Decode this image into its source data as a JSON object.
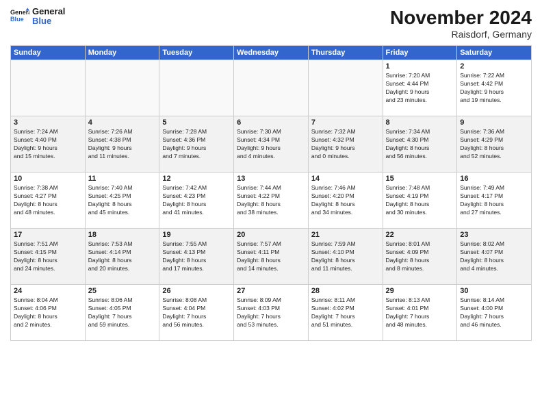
{
  "logo": {
    "line1": "General",
    "line2": "Blue"
  },
  "title": "November 2024",
  "subtitle": "Raisdorf, Germany",
  "days_of_week": [
    "Sunday",
    "Monday",
    "Tuesday",
    "Wednesday",
    "Thursday",
    "Friday",
    "Saturday"
  ],
  "weeks": [
    [
      {
        "day": "",
        "info": ""
      },
      {
        "day": "",
        "info": ""
      },
      {
        "day": "",
        "info": ""
      },
      {
        "day": "",
        "info": ""
      },
      {
        "day": "",
        "info": ""
      },
      {
        "day": "1",
        "info": "Sunrise: 7:20 AM\nSunset: 4:44 PM\nDaylight: 9 hours\nand 23 minutes."
      },
      {
        "day": "2",
        "info": "Sunrise: 7:22 AM\nSunset: 4:42 PM\nDaylight: 9 hours\nand 19 minutes."
      }
    ],
    [
      {
        "day": "3",
        "info": "Sunrise: 7:24 AM\nSunset: 4:40 PM\nDaylight: 9 hours\nand 15 minutes."
      },
      {
        "day": "4",
        "info": "Sunrise: 7:26 AM\nSunset: 4:38 PM\nDaylight: 9 hours\nand 11 minutes."
      },
      {
        "day": "5",
        "info": "Sunrise: 7:28 AM\nSunset: 4:36 PM\nDaylight: 9 hours\nand 7 minutes."
      },
      {
        "day": "6",
        "info": "Sunrise: 7:30 AM\nSunset: 4:34 PM\nDaylight: 9 hours\nand 4 minutes."
      },
      {
        "day": "7",
        "info": "Sunrise: 7:32 AM\nSunset: 4:32 PM\nDaylight: 9 hours\nand 0 minutes."
      },
      {
        "day": "8",
        "info": "Sunrise: 7:34 AM\nSunset: 4:30 PM\nDaylight: 8 hours\nand 56 minutes."
      },
      {
        "day": "9",
        "info": "Sunrise: 7:36 AM\nSunset: 4:29 PM\nDaylight: 8 hours\nand 52 minutes."
      }
    ],
    [
      {
        "day": "10",
        "info": "Sunrise: 7:38 AM\nSunset: 4:27 PM\nDaylight: 8 hours\nand 48 minutes."
      },
      {
        "day": "11",
        "info": "Sunrise: 7:40 AM\nSunset: 4:25 PM\nDaylight: 8 hours\nand 45 minutes."
      },
      {
        "day": "12",
        "info": "Sunrise: 7:42 AM\nSunset: 4:23 PM\nDaylight: 8 hours\nand 41 minutes."
      },
      {
        "day": "13",
        "info": "Sunrise: 7:44 AM\nSunset: 4:22 PM\nDaylight: 8 hours\nand 38 minutes."
      },
      {
        "day": "14",
        "info": "Sunrise: 7:46 AM\nSunset: 4:20 PM\nDaylight: 8 hours\nand 34 minutes."
      },
      {
        "day": "15",
        "info": "Sunrise: 7:48 AM\nSunset: 4:19 PM\nDaylight: 8 hours\nand 30 minutes."
      },
      {
        "day": "16",
        "info": "Sunrise: 7:49 AM\nSunset: 4:17 PM\nDaylight: 8 hours\nand 27 minutes."
      }
    ],
    [
      {
        "day": "17",
        "info": "Sunrise: 7:51 AM\nSunset: 4:15 PM\nDaylight: 8 hours\nand 24 minutes."
      },
      {
        "day": "18",
        "info": "Sunrise: 7:53 AM\nSunset: 4:14 PM\nDaylight: 8 hours\nand 20 minutes."
      },
      {
        "day": "19",
        "info": "Sunrise: 7:55 AM\nSunset: 4:13 PM\nDaylight: 8 hours\nand 17 minutes."
      },
      {
        "day": "20",
        "info": "Sunrise: 7:57 AM\nSunset: 4:11 PM\nDaylight: 8 hours\nand 14 minutes."
      },
      {
        "day": "21",
        "info": "Sunrise: 7:59 AM\nSunset: 4:10 PM\nDaylight: 8 hours\nand 11 minutes."
      },
      {
        "day": "22",
        "info": "Sunrise: 8:01 AM\nSunset: 4:09 PM\nDaylight: 8 hours\nand 8 minutes."
      },
      {
        "day": "23",
        "info": "Sunrise: 8:02 AM\nSunset: 4:07 PM\nDaylight: 8 hours\nand 4 minutes."
      }
    ],
    [
      {
        "day": "24",
        "info": "Sunrise: 8:04 AM\nSunset: 4:06 PM\nDaylight: 8 hours\nand 2 minutes."
      },
      {
        "day": "25",
        "info": "Sunrise: 8:06 AM\nSunset: 4:05 PM\nDaylight: 7 hours\nand 59 minutes."
      },
      {
        "day": "26",
        "info": "Sunrise: 8:08 AM\nSunset: 4:04 PM\nDaylight: 7 hours\nand 56 minutes."
      },
      {
        "day": "27",
        "info": "Sunrise: 8:09 AM\nSunset: 4:03 PM\nDaylight: 7 hours\nand 53 minutes."
      },
      {
        "day": "28",
        "info": "Sunrise: 8:11 AM\nSunset: 4:02 PM\nDaylight: 7 hours\nand 51 minutes."
      },
      {
        "day": "29",
        "info": "Sunrise: 8:13 AM\nSunset: 4:01 PM\nDaylight: 7 hours\nand 48 minutes."
      },
      {
        "day": "30",
        "info": "Sunrise: 8:14 AM\nSunset: 4:00 PM\nDaylight: 7 hours\nand 46 minutes."
      }
    ]
  ]
}
